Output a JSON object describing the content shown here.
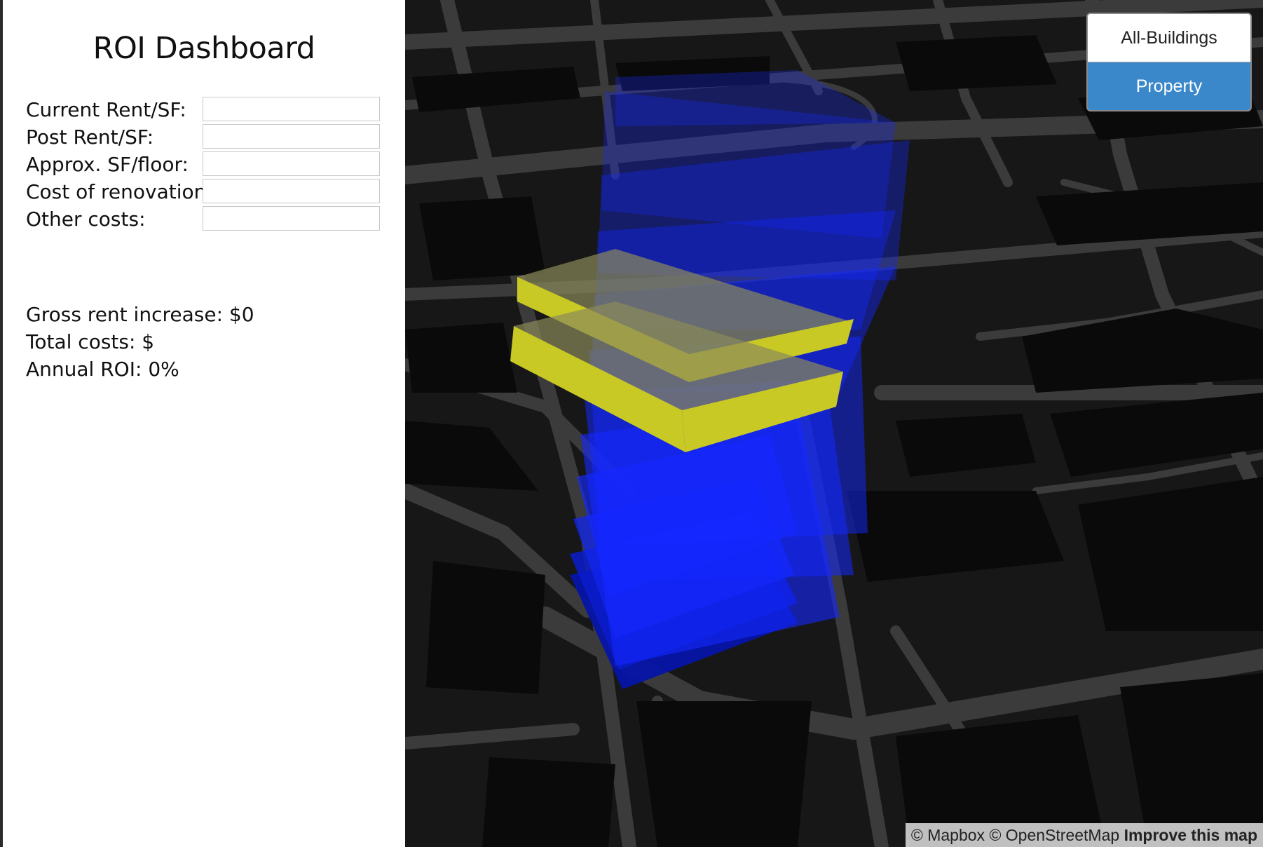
{
  "dashboard": {
    "title": "ROI Dashboard",
    "fields": [
      {
        "label": "Current Rent/SF:",
        "value": ""
      },
      {
        "label": "Post Rent/SF:",
        "value": ""
      },
      {
        "label": "Approx. SF/floor:",
        "value": ""
      },
      {
        "label": "Cost of renovation:",
        "value": ""
      },
      {
        "label": "Other costs:",
        "value": ""
      }
    ],
    "results": {
      "gross_rent": "Gross rent increase: $0",
      "total_costs": "Total costs: $",
      "annual_roi": "Annual ROI: 0%"
    }
  },
  "map": {
    "toggle": {
      "options": [
        "All-Buildings",
        "Property"
      ],
      "selected": "Property"
    },
    "attribution": {
      "mapbox": "© Mapbox",
      "osm": "© OpenStreetMap",
      "improve": "Improve this map"
    },
    "colors": {
      "background": "#171717",
      "streets": "#3a3a3a",
      "building_floors": "#1428ff",
      "selected_floors": "#c9c925",
      "toggle_active": "#3a87c9"
    }
  }
}
